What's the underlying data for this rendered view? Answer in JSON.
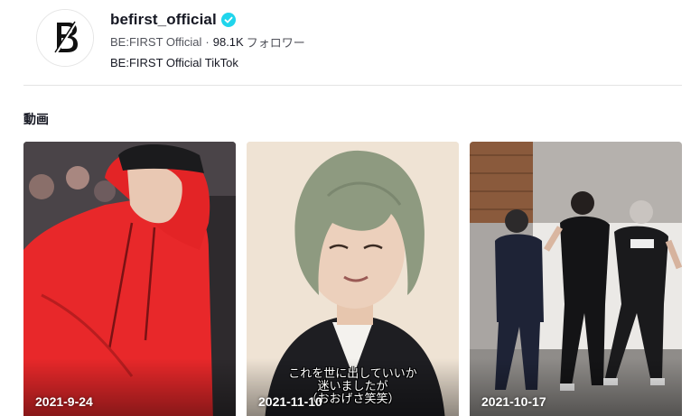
{
  "profile": {
    "username": "befirst_official",
    "display_name": "BE:FIRST Official",
    "separator": "·",
    "follower_count": "98.1K",
    "follower_label": "フォロワー",
    "bio": "BE:FIRST Official TikTok",
    "avatar_logo_text": "BE:FIRST",
    "verified_icon": "verified-badge-icon",
    "verified_color": "#20d5ec"
  },
  "section": {
    "title": "動画"
  },
  "videos": [
    {
      "date": "2021-9-24",
      "caption_lines": []
    },
    {
      "date": "2021-11-10",
      "caption_lines": [
        "これを世に出していいか",
        "迷いましたが",
        "（おおげさ笑笑）"
      ]
    },
    {
      "date": "2021-10-17",
      "caption_lines": []
    }
  ]
}
